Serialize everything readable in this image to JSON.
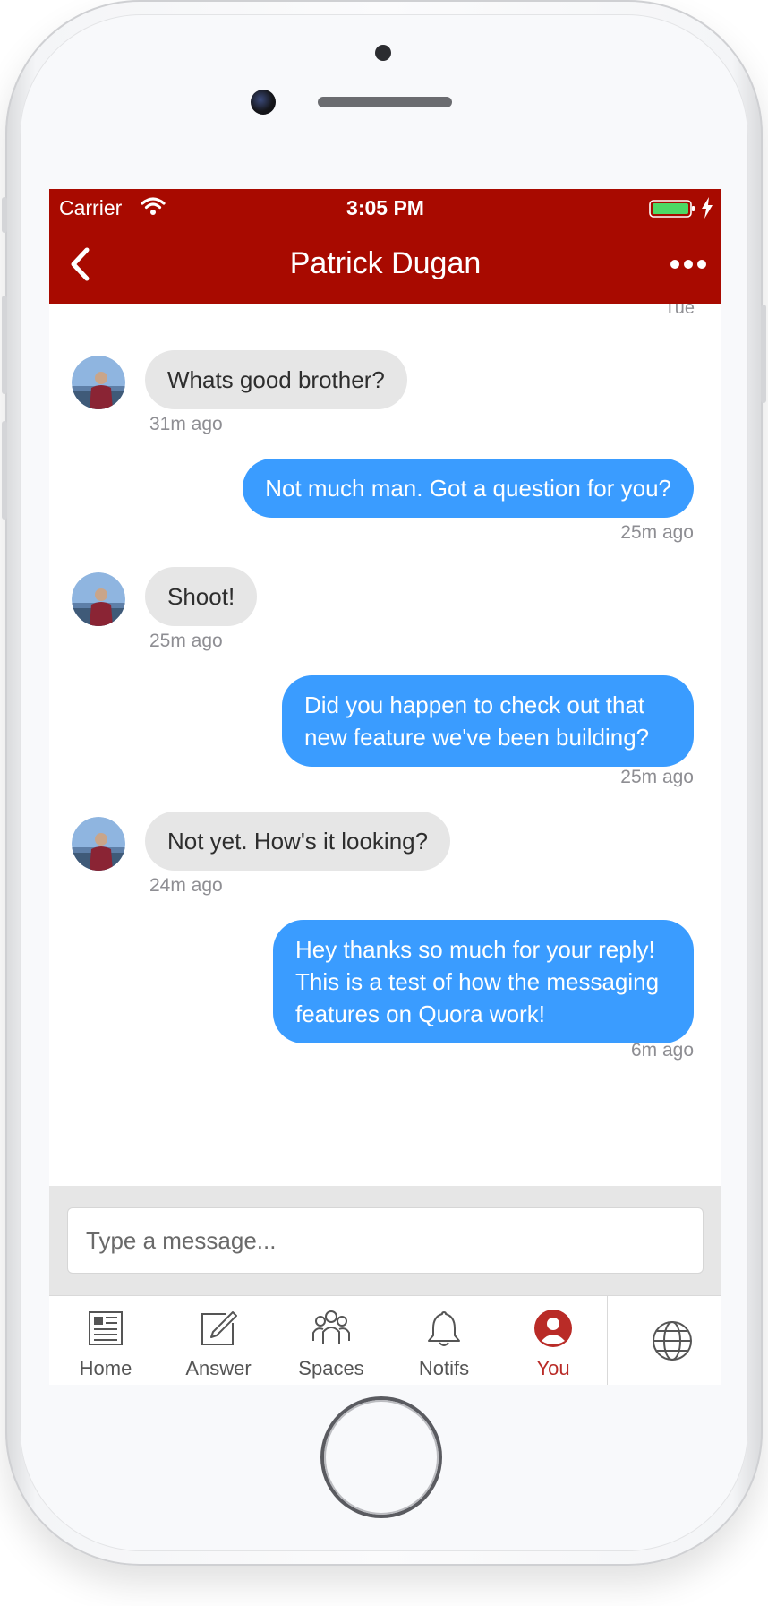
{
  "status_bar": {
    "carrier": "Carrier",
    "time": "3:05 PM",
    "icons": [
      "wifi-icon",
      "battery-icon",
      "charging-bolt-icon"
    ]
  },
  "header": {
    "title": "Patrick Dugan",
    "back_icon": "chevron-left-icon",
    "more_icon": "ellipsis-icon"
  },
  "conversation": {
    "day_label": "Tue",
    "messages": [
      {
        "direction": "incoming",
        "text": "Whats good brother?",
        "time": "31m ago"
      },
      {
        "direction": "outgoing",
        "text": "Not much man. Got a question for you?",
        "time": "25m ago"
      },
      {
        "direction": "incoming",
        "text": "Shoot!",
        "time": "25m ago"
      },
      {
        "direction": "outgoing",
        "text": "Did you happen to check out that new feature we've been building?",
        "time": "25m ago"
      },
      {
        "direction": "incoming",
        "text": "Not yet. How's it looking?",
        "time": "24m ago"
      },
      {
        "direction": "outgoing",
        "text": "Hey thanks so much for your reply! This is a test of how the messaging features on Quora work!",
        "time": "6m ago"
      }
    ]
  },
  "composer": {
    "placeholder": "Type a message...",
    "value": ""
  },
  "tab_bar": {
    "tabs": [
      {
        "label": "Home",
        "icon": "news-feed-icon",
        "active": false
      },
      {
        "label": "Answer",
        "icon": "pencil-square-icon",
        "active": false
      },
      {
        "label": "Spaces",
        "icon": "people-group-icon",
        "active": false
      },
      {
        "label": "Notifs",
        "icon": "bell-icon",
        "active": false
      },
      {
        "label": "You",
        "icon": "user-avatar-icon",
        "active": true
      }
    ],
    "extra_icon": "globe-icon"
  },
  "colors": {
    "header_red": "#a80a00",
    "outgoing_bubble": "#3a9cff",
    "incoming_bubble": "#e6e6e6",
    "active_tab": "#b92b27"
  }
}
